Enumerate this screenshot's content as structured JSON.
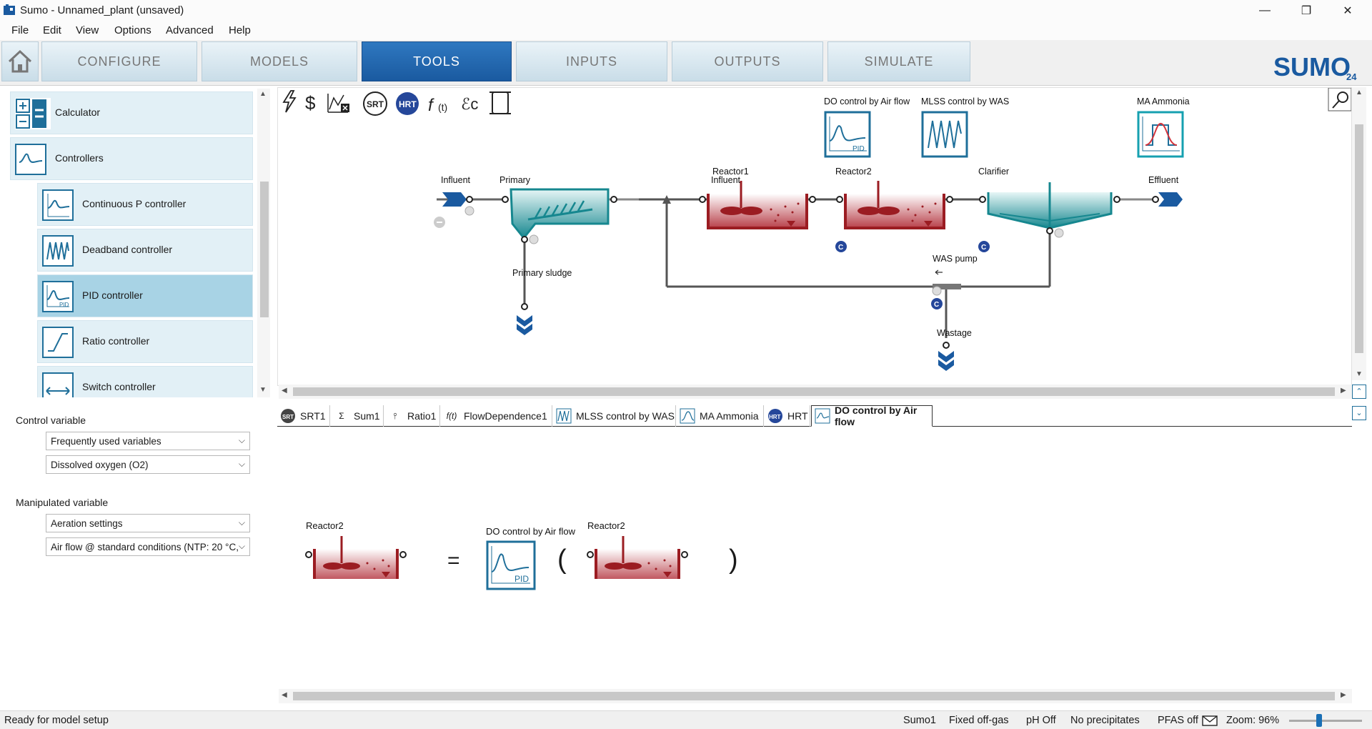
{
  "window": {
    "title": "Sumo - Unnamed_plant (unsaved)",
    "minimize": "—",
    "restore": "❐",
    "close": "✕"
  },
  "menu": [
    "File",
    "Edit",
    "View",
    "Options",
    "Advanced",
    "Help"
  ],
  "ribbon": {
    "tabs": [
      "CONFIGURE",
      "MODELS",
      "TOOLS",
      "INPUTS",
      "OUTPUTS",
      "SIMULATE"
    ],
    "active_tab": "TOOLS",
    "logo_text": "SUMO",
    "logo_version": "24"
  },
  "tool_list": {
    "items": [
      {
        "label": "Calculator",
        "icon": "calculator-icon",
        "indent": false,
        "selected": false
      },
      {
        "label": "Controllers",
        "icon": "controller-wave-icon",
        "indent": false,
        "selected": false
      },
      {
        "label": "Continuous P controller",
        "icon": "p-controller-icon",
        "indent": true,
        "selected": false
      },
      {
        "label": "Deadband controller",
        "icon": "deadband-icon",
        "indent": true,
        "selected": false
      },
      {
        "label": "PID controller",
        "icon": "pid-icon",
        "indent": true,
        "selected": true
      },
      {
        "label": "Ratio controller",
        "icon": "ratio-icon",
        "indent": true,
        "selected": false
      },
      {
        "label": "Switch controller",
        "icon": "switch-icon",
        "indent": true,
        "selected": false
      }
    ]
  },
  "properties": {
    "control_variable_label": "Control variable",
    "control_group": "Frequently used variables",
    "control_value": "Dissolved oxygen (O2)",
    "manipulated_variable_label": "Manipulated variable",
    "manipulated_group": "Aeration settings",
    "manipulated_value": "Air flow @ standard conditions (NTP: 20 °C,"
  },
  "canvas": {
    "toolbar": [
      "lightning-icon",
      "dollar-icon",
      "calc-remove-icon",
      "srt-icon",
      "hrt-icon",
      "function-icon",
      "footprint-icon",
      "scroll-icon"
    ],
    "toolbar_srt": "SRT",
    "toolbar_hrt": "HRT",
    "controllers": [
      {
        "label": "DO control by Air flow",
        "icon": "pid-icon"
      },
      {
        "label": "MLSS control by WAS",
        "icon": "deadband-icon"
      },
      {
        "label": "MA Ammonia",
        "icon": "moving-average-icon"
      }
    ],
    "units": {
      "influent": "Influent",
      "primary": "Primary",
      "reactor1": "Reactor1",
      "reactor2": "Reactor2",
      "clarifier": "Clarifier",
      "effluent": "Effluent",
      "primary_sludge": "Primary sludge",
      "was_pump": "WAS pump",
      "wastage": "Wastage"
    },
    "control_badge": "C"
  },
  "bottom_tabs": [
    {
      "label": "SRT1",
      "icon": "srt-icon"
    },
    {
      "label": "Sum1",
      "icon": "sigma-icon"
    },
    {
      "label": "Ratio1",
      "icon": "ratio-split-icon"
    },
    {
      "label": "FlowDependence1",
      "icon": "function-icon"
    },
    {
      "label": "MLSS control by WAS",
      "icon": "deadband-icon"
    },
    {
      "label": "MA Ammonia",
      "icon": "moving-average-icon"
    },
    {
      "label": "HRT",
      "icon": "hrt-icon"
    },
    {
      "label": "DO control by Air flow",
      "icon": "pid-icon",
      "active": true
    }
  ],
  "equation": {
    "lhs_label": "Reactor2",
    "equals": "=",
    "controller_label": "DO control by Air flow",
    "open_paren": "(",
    "arg_label": "Reactor2",
    "close_paren": ")"
  },
  "statusbar": {
    "message": "Ready for model setup",
    "model": "Sumo1",
    "offgas": "Fixed off-gas",
    "ph": "pH Off",
    "precip": "No precipitates",
    "pfas": "PFAS off",
    "zoom": "Zoom: 96%"
  },
  "colors": {
    "accent": "#1a5aa0",
    "reactor": "#9b1c22",
    "settler": "#16878f",
    "selection": "#a8d3e5"
  }
}
